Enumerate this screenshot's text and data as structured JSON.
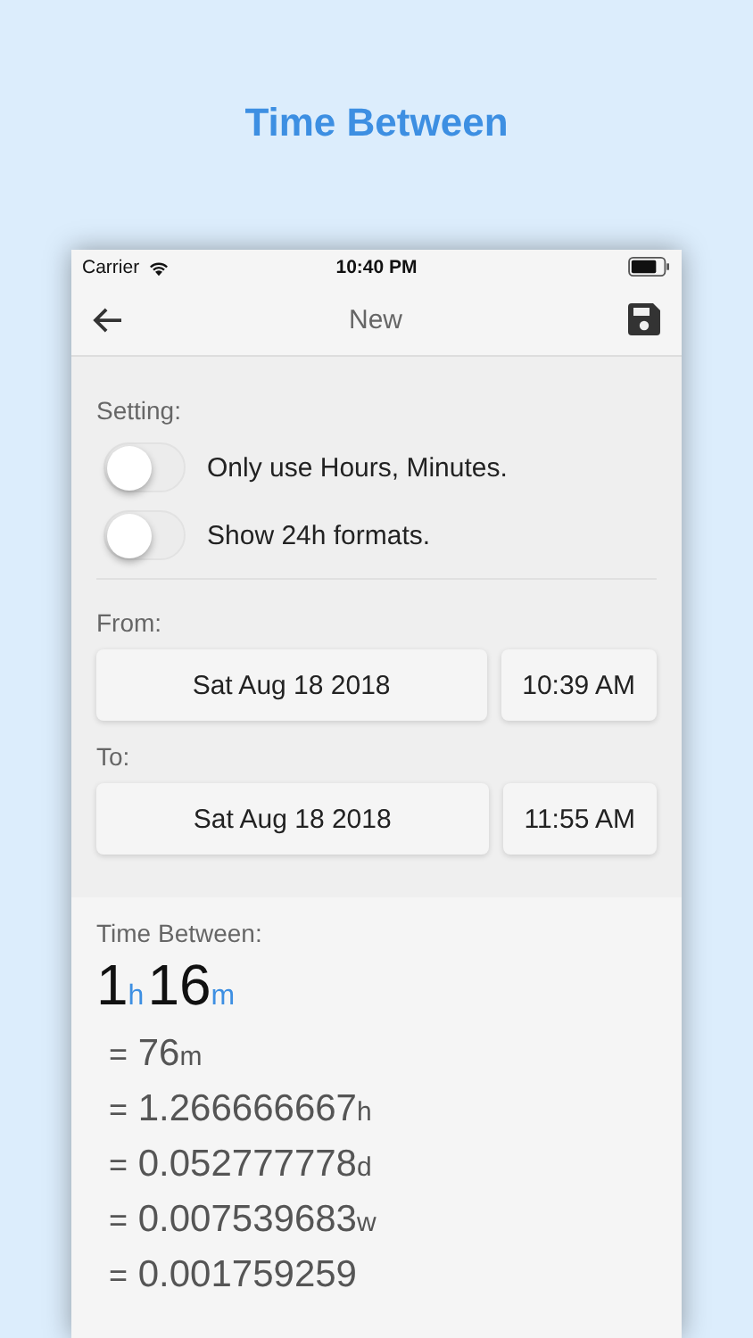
{
  "app_title": "Time Between",
  "status_bar": {
    "carrier": "Carrier",
    "time": "10:40 PM"
  },
  "nav": {
    "title": "New"
  },
  "settings": {
    "label": "Setting:",
    "toggles": [
      {
        "label": "Only use Hours, Minutes.",
        "on": false
      },
      {
        "label": "Show 24h formats.",
        "on": false
      }
    ]
  },
  "ranges": [
    {
      "label": "From:",
      "date": "Sat Aug 18 2018",
      "time": "10:39 AM"
    },
    {
      "label": "To:",
      "date": "Sat Aug 18 2018",
      "time": "11:55 AM"
    }
  ],
  "result": {
    "label": "Time Between:",
    "headline": [
      {
        "value": "1",
        "unit": "h"
      },
      {
        "value": "16",
        "unit": "m"
      }
    ],
    "conversions": [
      {
        "sign": "=",
        "value": "76",
        "unit": "m"
      },
      {
        "sign": "=",
        "value": "1.266666667",
        "unit": "h"
      },
      {
        "sign": "=",
        "value": "0.052777778",
        "unit": "d"
      },
      {
        "sign": "=",
        "value": "0.007539683",
        "unit": "w"
      },
      {
        "sign": "=",
        "value": "0.001759259"
      }
    ]
  }
}
